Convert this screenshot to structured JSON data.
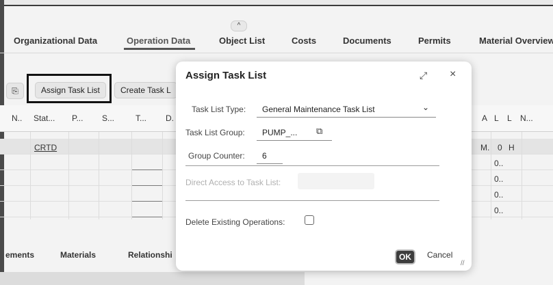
{
  "header": {
    "collapse_glyph": "^",
    "tabs": [
      {
        "label": "Organizational Data"
      },
      {
        "label": "Operation Data"
      },
      {
        "label": "Object List"
      },
      {
        "label": "Costs"
      },
      {
        "label": "Documents"
      },
      {
        "label": "Permits"
      },
      {
        "label": "Material Overview"
      }
    ]
  },
  "toolbar": {
    "copy_glyph": "⎘",
    "assign_task_list": "Assign Task List",
    "create_task_list": "Create Task L"
  },
  "table": {
    "headers": [
      "N..",
      "Stat...",
      "P...",
      "S...",
      "T...",
      "D.",
      "A",
      "L",
      "L",
      "N..."
    ],
    "row1_status": "CRTD",
    "row1_right": [
      "M.",
      "0",
      "H"
    ],
    "right_cells": [
      "0..",
      "0..",
      "0..",
      "0.."
    ]
  },
  "bottom_tabs": [
    "ements",
    "Materials",
    "Relationshi"
  ],
  "dialog": {
    "title": "Assign Task List",
    "expand_glyph": "⤢",
    "close_glyph": "×",
    "task_list_type_label": "Task List Type:",
    "task_list_type_value": "General Maintenance Task List",
    "chevron_glyph": "⌄",
    "task_list_group_label": "Task List Group:",
    "task_list_group_value": "PUMP_...",
    "value_help_glyph": "⧉",
    "group_counter_label": "Group Counter:",
    "group_counter_value": "6",
    "direct_access_label": "Direct Access to Task List:",
    "delete_ops_label": "Delete Existing Operations:",
    "ok_label": "OK",
    "cancel_label": "Cancel",
    "resize_glyph": "//"
  }
}
